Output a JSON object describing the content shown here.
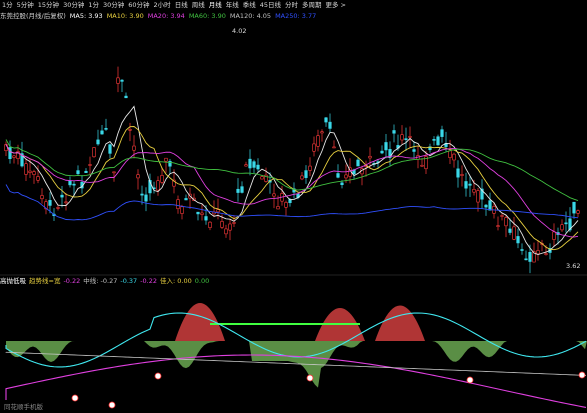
{
  "toolbar": {
    "items": [
      "1分",
      "5分钟",
      "15分钟",
      "30分钟",
      "1分",
      "30分钟",
      "60分钟",
      "2小时",
      "日线",
      "周线",
      "月线",
      "年线",
      "季线",
      "45日线",
      "分时",
      "多周期",
      "更多 >"
    ]
  },
  "price_info": {
    "symbol": "东莞控股(月线/后复权)",
    "ma5": "MA5: 3.93",
    "ma10": "MA10: 3.90",
    "ma20": "MA20: 3.94",
    "ma60": "MA60: 3.90",
    "ma120": "MA120: 4.05",
    "ma250": "MA250: 3.77"
  },
  "price_labels": {
    "high": "4.02",
    "low": "3.62"
  },
  "indicator": {
    "name": "高抛低吸",
    "param": "趋势线=宽",
    "v1": "-0.22",
    "v2": "中线: -0.27",
    "v3": "-0.37",
    "v4": "-0.22",
    "v5": "佳入: 0.00",
    "v6": "0.00"
  },
  "footer": "同花顺手机版",
  "colors": {
    "up": "#ff3b3b",
    "down": "#3ad8e8",
    "ma_white": "#e8e8e8",
    "ma_yellow": "#e8d040",
    "ma_magenta": "#e040e0",
    "ma_green": "#40c040",
    "ma_blue": "#3050ff",
    "green_area": "#5a8e45",
    "red_area": "#b03535"
  }
}
